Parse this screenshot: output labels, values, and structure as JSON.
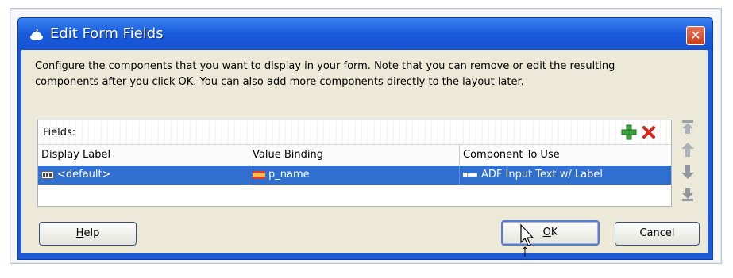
{
  "dialog": {
    "title": "Edit Form Fields",
    "close_glyph": "✕",
    "description_line1": "Configure the components that you want to display in your form.  Note that you can remove or edit the resulting",
    "description_line2": "components after you click OK.  You can also add more components directly to the layout later."
  },
  "fields_table": {
    "label": "Fields:",
    "columns": [
      "Display Label",
      "Value Binding",
      "Component To Use"
    ],
    "rows": [
      {
        "display_label": "<default>",
        "value_binding": "p_name",
        "component": "ADF Input Text w/ Label",
        "selected": true
      }
    ]
  },
  "toolbar_icons": [
    "add-icon",
    "delete-icon"
  ],
  "side_arrows": [
    "move-top-icon",
    "move-up-icon",
    "move-down-icon",
    "move-bottom-icon"
  ],
  "buttons": {
    "help_mnemonic": "H",
    "help_rest": "elp",
    "ok_mnemonic": "O",
    "ok_rest": "K",
    "cancel": "Cancel"
  },
  "colors": {
    "title_bar": "#1e5ad8",
    "selected_row": "#2f6fcf",
    "close_button": "#d4502f",
    "add_icon": "#39a23a",
    "delete_icon": "#d8281e"
  }
}
